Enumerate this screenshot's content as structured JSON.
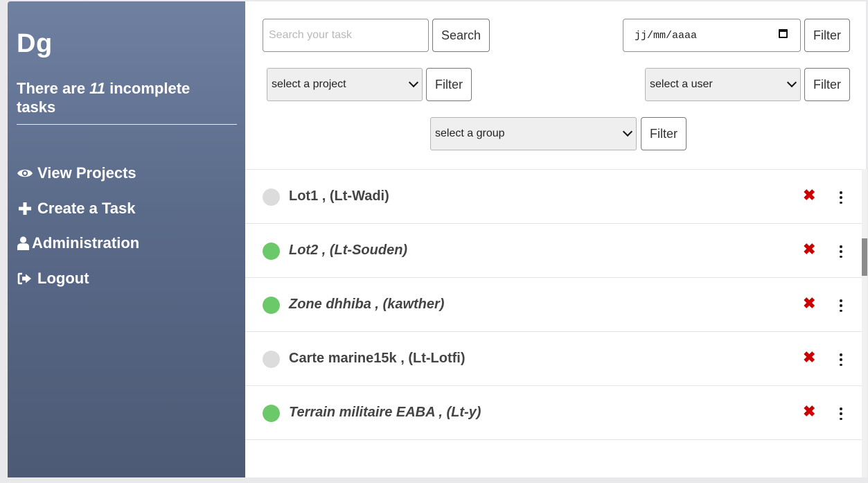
{
  "sidebar": {
    "brand": "Dg",
    "summary_prefix": "There are ",
    "incomplete_count": "11",
    "summary_suffix": " incomplete tasks",
    "nav": [
      {
        "label": "View Projects",
        "icon": "eye-icon"
      },
      {
        "label": "Create a Task",
        "icon": "plus-icon"
      },
      {
        "label": "Administration",
        "icon": "user-icon"
      },
      {
        "label": "Logout",
        "icon": "logout-icon"
      }
    ]
  },
  "filters": {
    "search_placeholder": "Search your task",
    "search_button": "Search",
    "date_value": "jj/mm/aaaa",
    "filter_label": "Filter",
    "project_select": "select a project",
    "user_select": "select a user",
    "group_select": "select a group"
  },
  "tasks": [
    {
      "title": "Lot1 , (Lt-Wadi)",
      "status": "incomplete",
      "italic": false
    },
    {
      "title": "Lot2 , (Lt-Souden)",
      "status": "complete",
      "italic": true
    },
    {
      "title": "Zone dhhiba , (kawther)",
      "status": "complete",
      "italic": true
    },
    {
      "title": "Carte marine15k , (Lt-Lotfi)",
      "status": "incomplete",
      "italic": false
    },
    {
      "title": "Terrain militaire EABA , (Lt-y)",
      "status": "complete",
      "italic": true
    }
  ],
  "colors": {
    "complete": "#6cc96a",
    "incomplete": "#dcdcdc",
    "delete": "#cc0000"
  },
  "icons": {
    "delete": "✖"
  }
}
